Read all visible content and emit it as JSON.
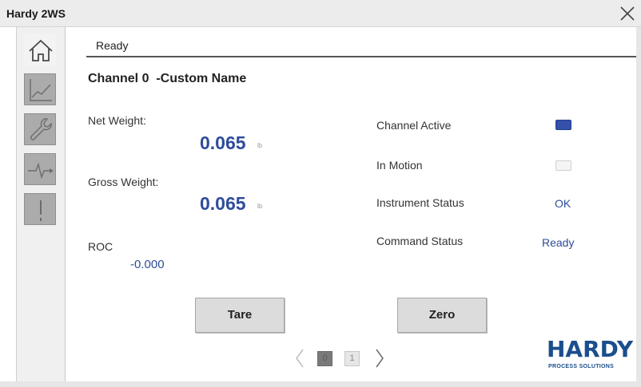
{
  "app": {
    "title": "Hardy 2WS"
  },
  "status": {
    "text": "Ready"
  },
  "channel": {
    "title": "Channel 0  -Custom Name"
  },
  "sidebar": {
    "items": [
      {
        "icon": "home-icon"
      },
      {
        "icon": "chart-icon"
      },
      {
        "icon": "wrench-icon"
      },
      {
        "icon": "waveform-icon"
      },
      {
        "icon": "alert-icon"
      }
    ]
  },
  "weights": {
    "net_label": "Net Weight:",
    "net_value": "0.065",
    "net_unit": "lb",
    "gross_label": "Gross Weight:",
    "gross_value": "0.065",
    "gross_unit": "lb",
    "roc_label": "ROC",
    "roc_value": "-0.000"
  },
  "status_panel": {
    "channel_active_label": "Channel Active",
    "channel_active": true,
    "in_motion_label": "In Motion",
    "in_motion": false,
    "instrument_status_label": "Instrument Status",
    "instrument_status_value": "OK",
    "command_status_label": "Command Status",
    "command_status_value": "Ready"
  },
  "buttons": {
    "tare": "Tare",
    "zero": "Zero"
  },
  "pager": {
    "pages": [
      "0",
      "1"
    ],
    "current": 0
  },
  "logo": {
    "main": "HARDY",
    "sub": "PROCESS SOLUTIONS"
  },
  "colors": {
    "value_blue": "#2e4c9a",
    "indicator_on": "#3450a8",
    "logo_blue": "#1b4e8c"
  }
}
